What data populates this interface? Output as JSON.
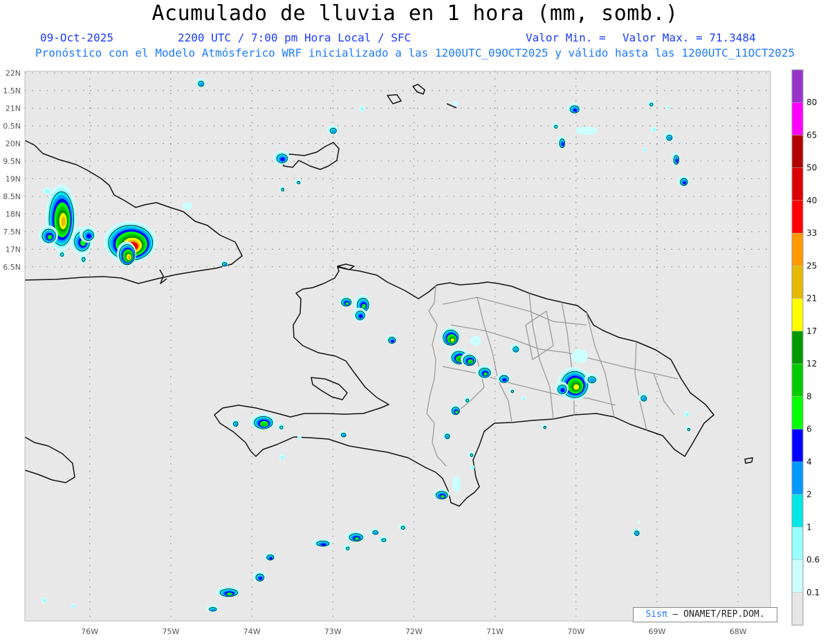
{
  "header": {
    "title": "Acumulado de lluvia en 1 hora (mm, somb.)",
    "date": "09-Oct-2025",
    "time": "2200 UTC / 7:00 pm Hora Local / SFC",
    "min_label": "Valor Min. =",
    "max_label": "Valor Max. = 71.3484",
    "subtitle": "Pronóstico con el Modelo Atmósferico WRF inicializado a las 1200UTC_09OCT2025 y válido hasta las  1200UTC_11OCT2025"
  },
  "map": {
    "lon_range": [
      -76.8,
      -67.6
    ],
    "lat_range": [
      6.45,
      22.05
    ],
    "lat_ticks": [
      "22N",
      "1.5N",
      "21N",
      "0.5N",
      "20N",
      "9.5N",
      "19N",
      "8.5N",
      "18N",
      "7.5N",
      "17N",
      "6.5N"
    ],
    "lon_ticks": [
      "76W",
      "75W",
      "74W",
      "73W",
      "72W",
      "71W",
      "70W",
      "69W",
      "68W"
    ],
    "colors": {
      "ocean": "#e8e8e8",
      "coast": "#111111",
      "border": "#9a9a9a",
      "grid": "#8c8c8c",
      "tick_text": "#555555"
    }
  },
  "legend": {
    "labels": [
      "0.1",
      "0.6",
      "1",
      "2",
      "4",
      "6",
      "8",
      "12",
      "17",
      "21",
      "25",
      "33",
      "40",
      "50",
      "65",
      "80"
    ],
    "colors": [
      "#e6e6e6",
      "#ccffff",
      "#99ffff",
      "#00e6e6",
      "#0099ff",
      "#0000ff",
      "#00ff00",
      "#00cc00",
      "#009900",
      "#ffff00",
      "#e6b800",
      "#ff9900",
      "#ff0000",
      "#dd0000",
      "#b00000",
      "#ff00ff",
      "#9933cc"
    ]
  },
  "credit": {
    "logo": "Sisπ",
    "text": "– ONAMET/REP.DOM."
  }
}
